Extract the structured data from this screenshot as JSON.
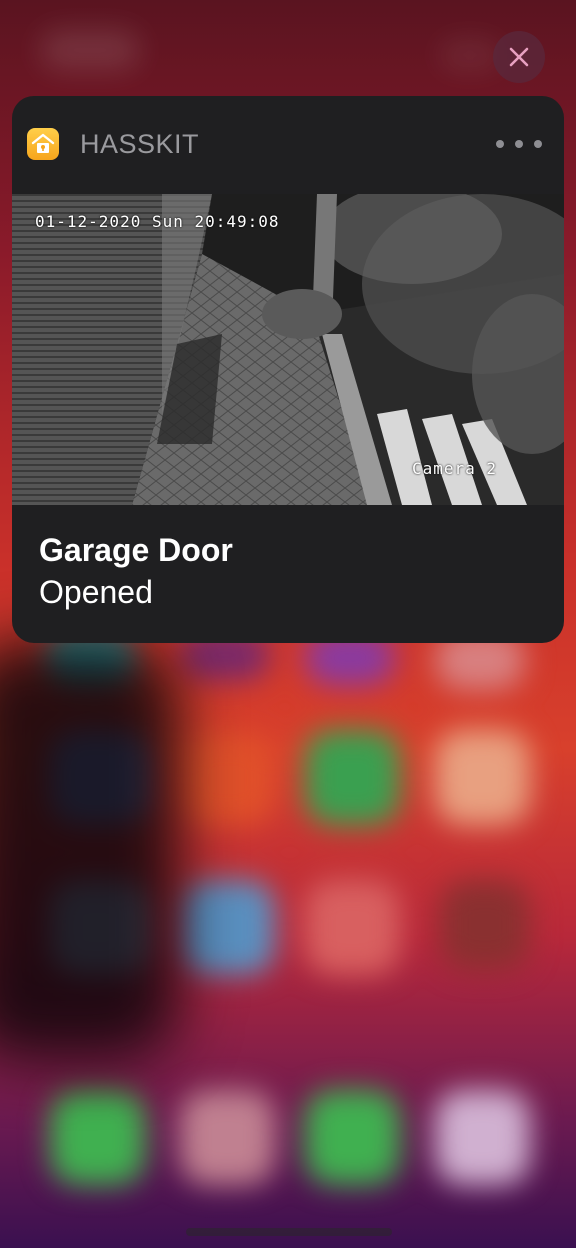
{
  "notification": {
    "app_name": "HASSKIT",
    "app_icon": "home-icon",
    "title": "Garage Door",
    "message": "Opened",
    "camera": {
      "timestamp": "01-12-2020 Sun 20:49:08",
      "label": "Camera 2"
    }
  },
  "controls": {
    "close_icon": "close-icon",
    "more_icon": "more-icon"
  },
  "colors": {
    "card_bg": "#1f1f21",
    "app_icon_bg": "#f7a51c",
    "app_name": "#9a9a9e",
    "text": "#ffffff"
  }
}
